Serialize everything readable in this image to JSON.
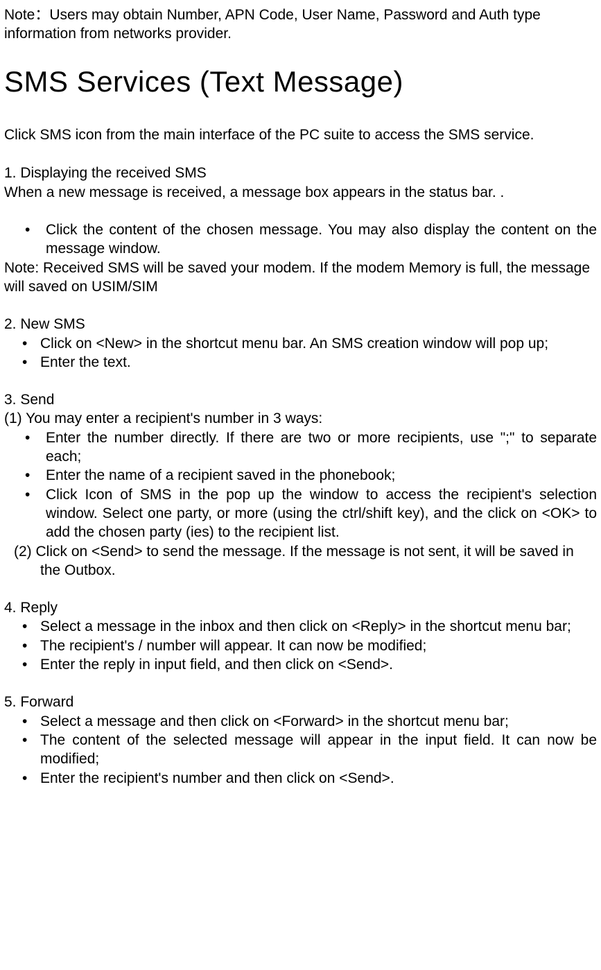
{
  "top_note": "Note：Users may obtain Number, APN Code, User Name, Password and Auth type information from networks provider.",
  "heading": "SMS Services (Text Message)",
  "intro": "Click SMS icon from the main interface of the PC suite to access the SMS service.",
  "section1": {
    "title": "1. Displaying the received SMS",
    "body": "When a new message is received, a message box appears in the status bar. .",
    "bullets": [
      "Click the content of the chosen message. You may also display the content on the message window."
    ],
    "note": "Note: Received SMS will be saved your modem. If the modem Memory is full, the message will saved on USIM/SIM"
  },
  "section2": {
    "title": "2. New SMS",
    "bullets": [
      "Click on <New> in the shortcut menu bar. An SMS creation window will pop up;",
      "Enter the text."
    ]
  },
  "section3": {
    "title": "3. Send",
    "sub1_intro": "(1) You may enter a recipient's number in 3 ways:",
    "bullets": [
      "Enter the number directly. If there are two or more recipients, use \";\" to separate each;",
      "Enter the name of a recipient saved in the phonebook;",
      "Click Icon of SMS in the pop up the window to access the recipient's selection window. Select one party, or more (using the ctrl/shift key), and the click on <OK> to add the chosen party (ies) to the recipient list."
    ],
    "sub2": "(2) Click on <Send> to send the message. If the message is not sent, it will be saved in the Outbox."
  },
  "section4": {
    "title": "4. Reply",
    "bullets": [
      "Select a message in the inbox and then click on <Reply> in the shortcut menu bar;",
      "The recipient's / number will appear. It can now be modified;",
      "Enter the reply in input field, and then click on <Send>."
    ]
  },
  "section5": {
    "title": "5. Forward",
    "bullets": [
      "Select a message and then click on <Forward> in the shortcut menu bar;",
      "The content of the selected message will appear in the input field. It can now be modified;",
      "Enter the recipient's number and then click on <Send>."
    ]
  }
}
